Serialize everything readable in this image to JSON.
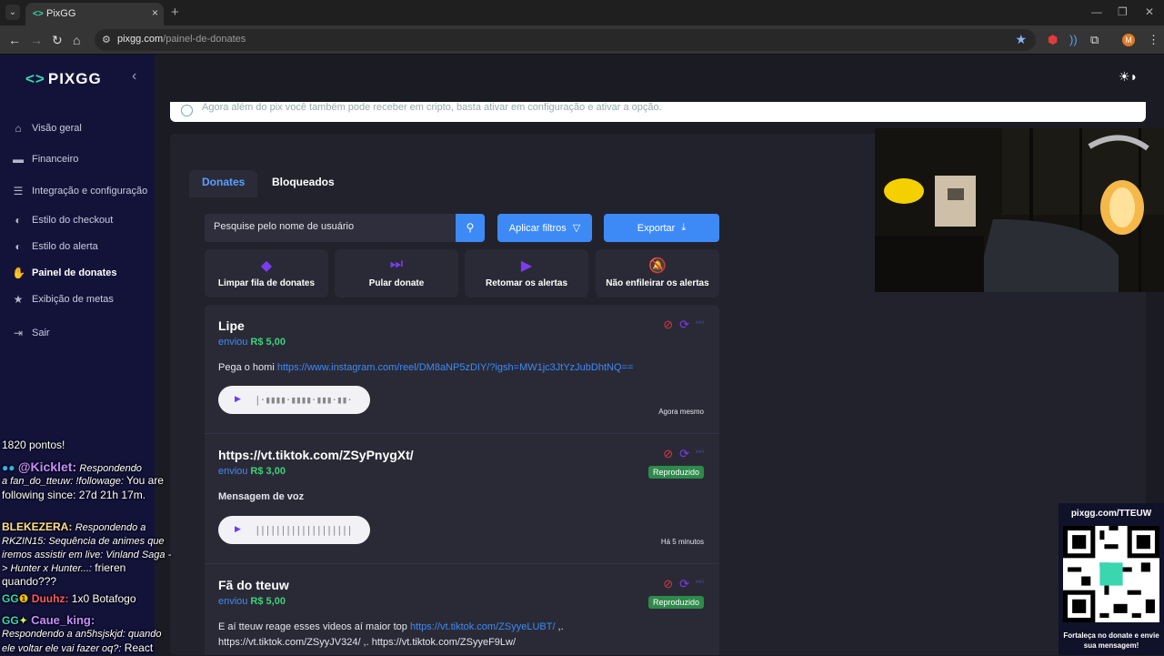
{
  "browser": {
    "tab_title": "PixGG",
    "url_host": "pixgg.com",
    "url_path": "/painel-de-donates",
    "avatar_letter": "M"
  },
  "sidebar": {
    "logo": "PIXGG",
    "items": [
      {
        "label": "Visão geral",
        "icon": "home-icon"
      },
      {
        "label": "Financeiro",
        "icon": "wallet-icon"
      },
      {
        "label": "Integração e configuração",
        "icon": "settings-icon"
      },
      {
        "label": "Estilo do checkout",
        "icon": "palette-icon"
      },
      {
        "label": "Estilo do alerta",
        "icon": "palette-icon"
      },
      {
        "label": "Painel de donates",
        "icon": "donate-icon"
      },
      {
        "label": "Exibição de metas",
        "icon": "star-icon"
      },
      {
        "label": "Sair",
        "icon": "logout-icon"
      }
    ],
    "active_item": "Painel de donates"
  },
  "main": {
    "notice_text": "Agora além do pix você também pode receber em cripto, basta ativar em configuração e ativar a opção.",
    "tabs": [
      {
        "label": "Donates"
      },
      {
        "label": "Bloqueados"
      }
    ],
    "search_placeholder": "Pesquise pelo nome de usuário",
    "filter_button": "Aplicar filtros",
    "export_button": "Exportar",
    "actions": [
      {
        "label": "Limpar fila de donates",
        "icon": "eraser-icon"
      },
      {
        "label": "Pular donate",
        "icon": "skip-icon"
      },
      {
        "label": "Retomar os alertas",
        "icon": "play-icon"
      },
      {
        "label": "Não enfileirar os alertas",
        "icon": "bell-off-icon"
      }
    ],
    "donates": [
      {
        "name": "Lipe",
        "sent_label": "enviou",
        "amount": "R$ 5,00",
        "message": "Pega o homi",
        "link": "https://www.instagram.com/reel/DM8aNP5zDIY/?igsh=MW1jc3JtYzJubDhtNQ==",
        "time": "Agora mesmo",
        "badge": ""
      },
      {
        "name": "https://vt.tiktok.com/ZSyPnygXt/",
        "sent_label": "enviou",
        "amount": "R$ 3,00",
        "message": "Mensagem de voz",
        "link": "",
        "time": "Há 5 minutos",
        "badge": "Reproduzido"
      },
      {
        "name": "Fã do tteuw",
        "sent_label": "enviou",
        "amount": "R$ 5,00",
        "message": "E aí tteuw reage esses videos aí maior top",
        "link": "https://vt.tiktok.com/ZSyyeLUBT/",
        "message2": "https://vt.tiktok.com/ZSyyJV324/ ,. https://vt.tiktok.com/ZSyyeF9Lw/",
        "time": "",
        "badge": "Reproduzido"
      }
    ]
  },
  "overlay": {
    "chat": [
      {
        "user": "",
        "text": "1820 pontos!"
      },
      {
        "user": "@Kicklet:",
        "text": "Respondendo a fan_do_tteuw: !followage: You are following since: 27d 21h 17m."
      },
      {
        "user": "BLEKEZERA:",
        "text": "Respondendo a RKZIN15: Sequência de animes que iremos assistir em live: Vinland Saga -> Hunter x Hunter...: frieren quando???"
      },
      {
        "user": "Duuhz:",
        "text": "1x0 Botafogo"
      },
      {
        "user": "Caue_king:",
        "text": "Respondendo a an5hsjskjd: quando ele voltar ele vai fazer oq?: React"
      }
    ],
    "qr_url": "pixgg.com/TTEUW",
    "qr_caption": "Fortaleça no donate e envie sua mensagem!"
  }
}
